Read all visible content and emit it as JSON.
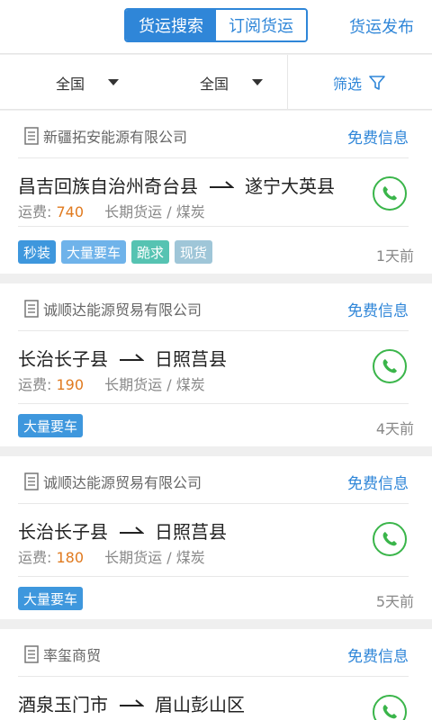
{
  "header": {
    "tab_search": "货运搜索",
    "tab_subscribe": "订阅货运",
    "publish": "货运发布"
  },
  "filters": {
    "origin": "全国",
    "destination": "全国",
    "screen": "筛选"
  },
  "colors": {
    "primary": "#2f86d8",
    "price": "#e07a1f",
    "phone": "#3ab54a",
    "tag_blue": "#3e97dd",
    "tag_lightblue": "#6fb3ea",
    "tag_teal": "#56c3b2",
    "tag_gray": "#9fc6d8"
  },
  "listings": [
    {
      "company": "新疆拓安能源有限公司",
      "free_label": "免费信息",
      "origin": "昌吉回族自治州奇台县",
      "destination": "遂宁大英县",
      "fee_label": "运费: ",
      "fee": "740",
      "detail": "长期货运 / 煤炭",
      "tags": [
        "秒装",
        "大量要车",
        "跪求",
        "现货"
      ],
      "posted": "1天前"
    },
    {
      "company": "诚顺达能源贸易有限公司",
      "free_label": "免费信息",
      "origin": "长治长子县",
      "destination": "日照莒县",
      "fee_label": "运费: ",
      "fee": "190",
      "detail": "长期货运 / 煤炭",
      "tags": [
        "大量要车"
      ],
      "posted": "4天前"
    },
    {
      "company": "诚顺达能源贸易有限公司",
      "free_label": "免费信息",
      "origin": "长治长子县",
      "destination": "日照莒县",
      "fee_label": "运费: ",
      "fee": "180",
      "detail": "长期货运 / 煤炭",
      "tags": [
        "大量要车"
      ],
      "posted": "5天前"
    },
    {
      "company": "率玺商贸",
      "free_label": "免费信息",
      "origin": "酒泉玉门市",
      "destination": "眉山彭山区"
    }
  ]
}
